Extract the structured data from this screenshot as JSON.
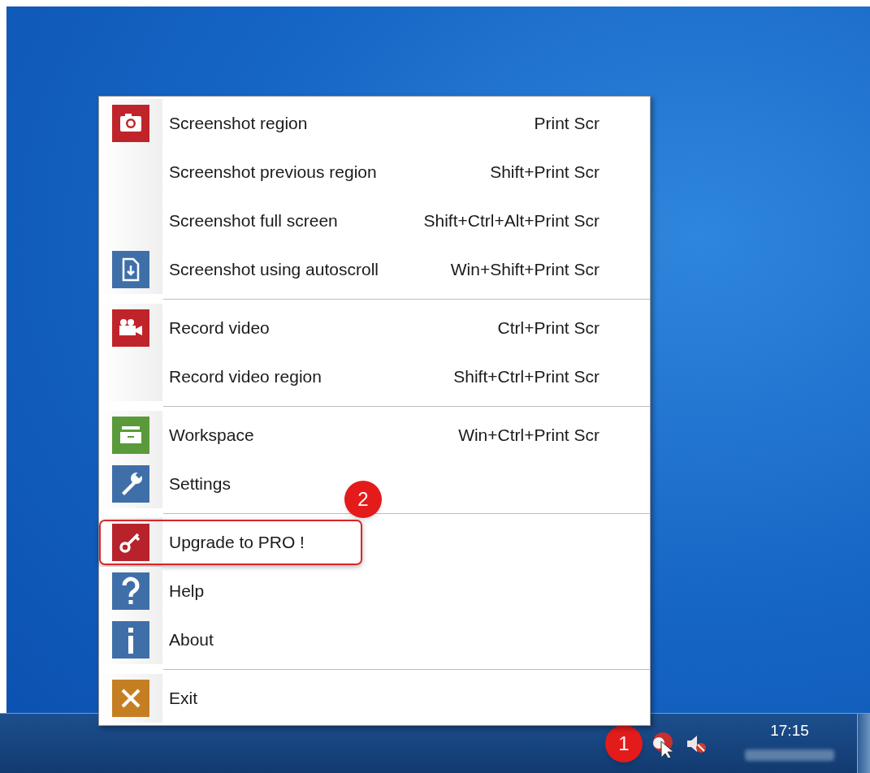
{
  "menu": {
    "items": [
      {
        "kind": "item",
        "label": "Screenshot region",
        "shortcut": "Print Scr"
      },
      {
        "kind": "item",
        "label": "Screenshot previous region",
        "shortcut": "Shift+Print Scr"
      },
      {
        "kind": "item",
        "label": "Screenshot full screen",
        "shortcut": "Shift+Ctrl+Alt+Print Scr"
      },
      {
        "kind": "item",
        "label": "Screenshot using autoscroll",
        "shortcut": "Win+Shift+Print Scr"
      },
      {
        "kind": "separator"
      },
      {
        "kind": "item",
        "label": "Record video",
        "shortcut": "Ctrl+Print Scr"
      },
      {
        "kind": "item",
        "label": "Record video region",
        "shortcut": "Shift+Ctrl+Print Scr"
      },
      {
        "kind": "separator"
      },
      {
        "kind": "item",
        "label": "Workspace",
        "shortcut": "Win+Ctrl+Print Scr"
      },
      {
        "kind": "item",
        "label": "Settings"
      },
      {
        "kind": "separator"
      },
      {
        "kind": "item",
        "label": "Upgrade to PRO !",
        "callout": "2"
      },
      {
        "kind": "item",
        "label": "Help"
      },
      {
        "kind": "item",
        "label": "About"
      },
      {
        "kind": "separator"
      },
      {
        "kind": "item",
        "label": "Exit"
      }
    ]
  },
  "taskbar": {
    "callout": "1",
    "clock": "17:15"
  }
}
